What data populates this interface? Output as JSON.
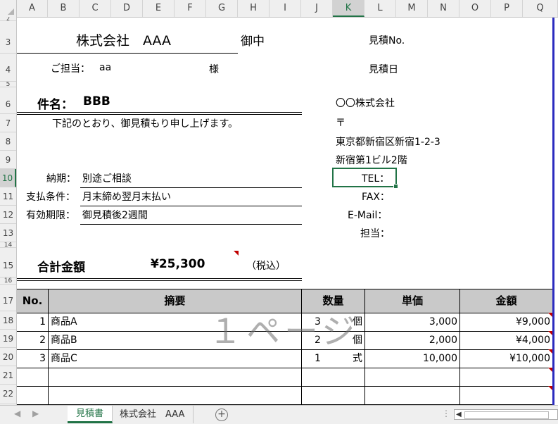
{
  "columns": [
    "A",
    "B",
    "C",
    "D",
    "E",
    "F",
    "G",
    "H",
    "I",
    "J",
    "K",
    "L",
    "M",
    "N",
    "O",
    "P",
    "Q"
  ],
  "rows": [
    "2",
    "3",
    "4",
    "5",
    "6",
    "7",
    "8",
    "9",
    "10",
    "11",
    "12",
    "13",
    "14",
    "15",
    "16",
    "17",
    "18",
    "19",
    "20",
    "21",
    "22"
  ],
  "selected_column": "K",
  "selected_row": "10",
  "header": {
    "company": "株式会社　AAA",
    "honorific": "御中",
    "contact_label": "ご担当：",
    "contact_name": "aa",
    "sama": "様",
    "estimate_no_label": "見積No.",
    "estimate_date_label": "見積日"
  },
  "subject": {
    "label": "件名：",
    "value": "BBB",
    "intro": "下記のとおり、御見積もり申し上げます。"
  },
  "terms": [
    {
      "label": "納期：",
      "value": "別途ご相談"
    },
    {
      "label": "支払条件：",
      "value": "月末締め翌月末払い"
    },
    {
      "label": "有効期限：",
      "value": "御見積後2週間"
    }
  ],
  "sender": {
    "name": "〇〇株式会社",
    "postal": "〒",
    "address1": "東京都新宿区新宿1-2-3",
    "address2": "新宿第1ビル2階",
    "tel_label": "TEL：",
    "fax_label": "FAX：",
    "email_label": "E-Mail：",
    "person_label": "担当："
  },
  "total": {
    "label": "合計金額",
    "value": "¥25,300",
    "tax_note": "（税込）"
  },
  "table": {
    "headers": [
      "No.",
      "摘要",
      "数量",
      "単価",
      "金額"
    ],
    "rows": [
      {
        "no": "1",
        "item": "商品A",
        "qty": "3",
        "unit": "個",
        "price": "3,000",
        "amount": "¥9,000"
      },
      {
        "no": "2",
        "item": "商品B",
        "qty": "2",
        "unit": "個",
        "price": "2,000",
        "amount": "¥4,000"
      },
      {
        "no": "3",
        "item": "商品C",
        "qty": "1",
        "unit": "式",
        "price": "10,000",
        "amount": "¥10,000"
      },
      {
        "no": "",
        "item": "",
        "qty": "",
        "unit": "",
        "price": "",
        "amount": ""
      },
      {
        "no": "",
        "item": "",
        "qty": "",
        "unit": "",
        "price": "",
        "amount": ""
      }
    ]
  },
  "watermark": "１ページ",
  "tabs": {
    "active": "見積書",
    "other": "株式会社　AAA",
    "add": "+"
  },
  "colors": {
    "accent": "#217346",
    "header_fill": "#c9c9c9",
    "page_break": "#2b2bbf",
    "comment_marker": "#c00000"
  }
}
